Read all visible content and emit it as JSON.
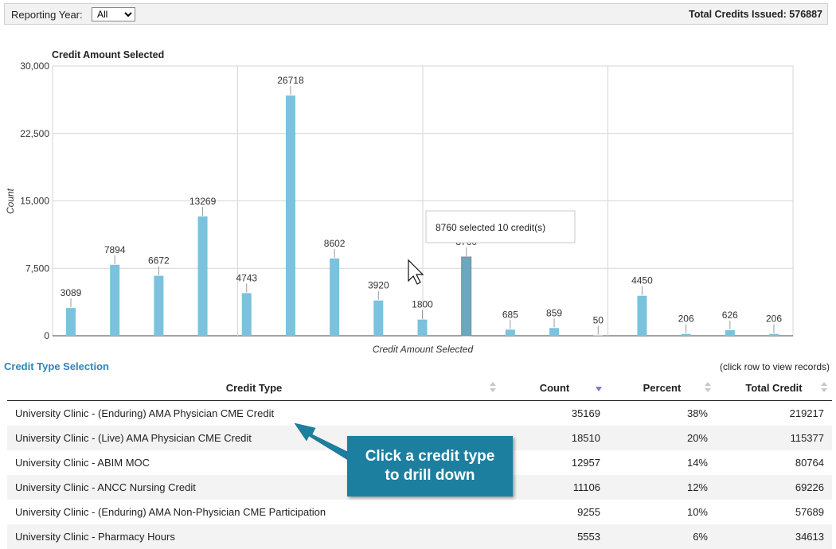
{
  "toolbar": {
    "reporting_year_label": "Reporting Year:",
    "reporting_year_value": "All",
    "total_credits": "Total Credits Issued: 576887"
  },
  "chart_data": {
    "type": "bar",
    "title": "Credit Amount Selected",
    "xlabel": "Credit Amount Selected",
    "ylabel": "Count",
    "ylim": [
      0,
      30000
    ],
    "yticks": [
      "0",
      "7,500",
      "15,000",
      "22,500",
      "30,000"
    ],
    "values": [
      3089,
      7894,
      6672,
      13269,
      4743,
      26718,
      8602,
      3920,
      1800,
      8760,
      685,
      859,
      50,
      4450,
      206,
      626,
      206
    ],
    "highlight_index": 9,
    "tooltip": "8760 selected 10 credit(s)",
    "color": "#7ac2dd",
    "highlight_color": "#6aa8c2"
  },
  "section": {
    "title": "Credit Type Selection",
    "hint": "(click row to view records)"
  },
  "table": {
    "headers": [
      "Credit Type",
      "Count",
      "Percent",
      "Total Credit"
    ],
    "rows": [
      [
        "University Clinic - (Enduring) AMA Physician CME Credit",
        "35169",
        "38%",
        "219217"
      ],
      [
        "University Clinic - (Live) AMA Physician CME Credit",
        "18510",
        "20%",
        "115377"
      ],
      [
        "University Clinic - ABIM MOC",
        "12957",
        "14%",
        "80764"
      ],
      [
        "University Clinic - ANCC Nursing Credit",
        "11106",
        "12%",
        "69226"
      ],
      [
        "University Clinic - (Enduring) AMA Non-Physician CME Participation",
        "9255",
        "10%",
        "57689"
      ],
      [
        "University Clinic - Pharmacy Hours",
        "5553",
        "6%",
        "34613"
      ]
    ]
  },
  "callout": {
    "line1": "Click a credit type",
    "line2": "to drill down"
  }
}
